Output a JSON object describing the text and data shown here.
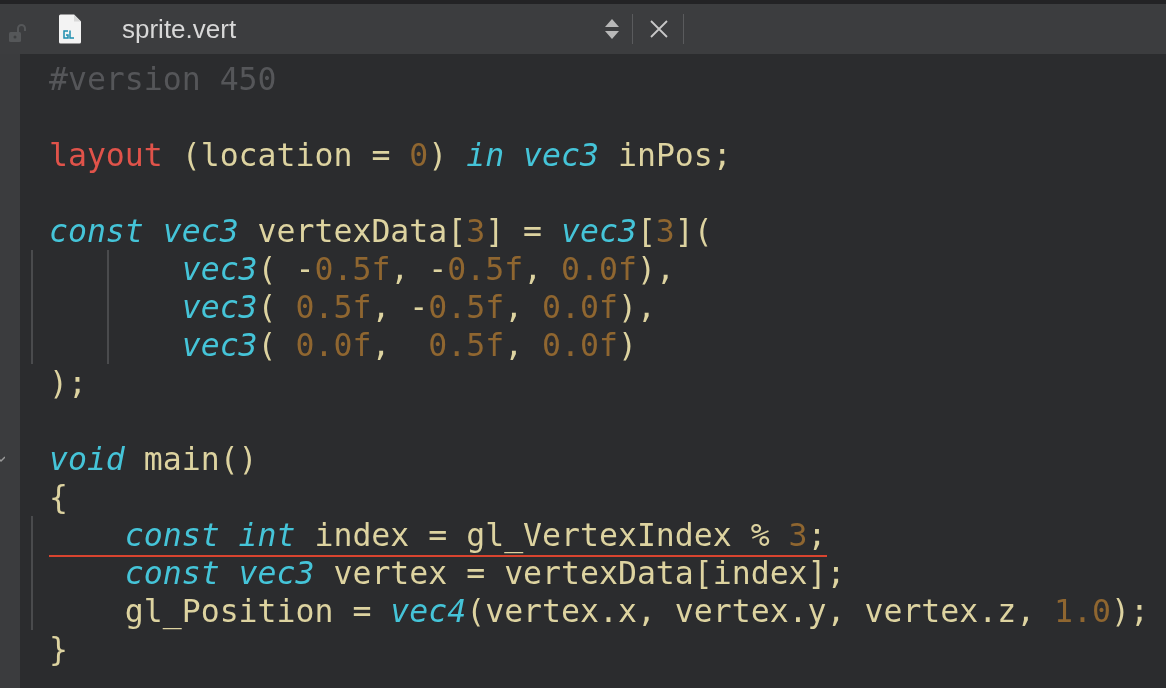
{
  "tab": {
    "title": "sprite.vert",
    "locked": false
  },
  "code": [
    {
      "kind": "code",
      "tokens": [
        {
          "t": "#version 450",
          "kind": "directive"
        }
      ]
    },
    {
      "kind": "blank"
    },
    {
      "kind": "code",
      "tokens": [
        {
          "t": "layout",
          "kind": "qualifier"
        },
        {
          "t": " (location = ",
          "kind": "plain"
        },
        {
          "t": "0",
          "kind": "number"
        },
        {
          "t": ") ",
          "kind": "plain"
        },
        {
          "t": "in vec3",
          "kind": "keyword"
        },
        {
          "t": " inPos;",
          "kind": "plain"
        }
      ]
    },
    {
      "kind": "blank"
    },
    {
      "kind": "code",
      "tokens": [
        {
          "t": "const vec3",
          "kind": "keyword"
        },
        {
          "t": " vertexData[",
          "kind": "plain"
        },
        {
          "t": "3",
          "kind": "number"
        },
        {
          "t": "] = ",
          "kind": "plain"
        },
        {
          "t": "vec3",
          "kind": "keyword"
        },
        {
          "t": "[",
          "kind": "plain"
        },
        {
          "t": "3",
          "kind": "number"
        },
        {
          "t": "](",
          "kind": "plain"
        }
      ]
    },
    {
      "kind": "code",
      "tokens": [
        {
          "t": "       vec3",
          "kind": "keyword"
        },
        {
          "t": "( -",
          "kind": "plain"
        },
        {
          "t": "0.5f",
          "kind": "number"
        },
        {
          "t": ", -",
          "kind": "plain"
        },
        {
          "t": "0.5f",
          "kind": "number"
        },
        {
          "t": ", ",
          "kind": "plain"
        },
        {
          "t": "0.0f",
          "kind": "number"
        },
        {
          "t": "),",
          "kind": "plain"
        }
      ]
    },
    {
      "kind": "code",
      "tokens": [
        {
          "t": "       vec3",
          "kind": "keyword"
        },
        {
          "t": "( ",
          "kind": "plain"
        },
        {
          "t": "0.5f",
          "kind": "number"
        },
        {
          "t": ", -",
          "kind": "plain"
        },
        {
          "t": "0.5f",
          "kind": "number"
        },
        {
          "t": ", ",
          "kind": "plain"
        },
        {
          "t": "0.0f",
          "kind": "number"
        },
        {
          "t": "),",
          "kind": "plain"
        }
      ]
    },
    {
      "kind": "code",
      "tokens": [
        {
          "t": "       vec3",
          "kind": "keyword"
        },
        {
          "t": "( ",
          "kind": "plain"
        },
        {
          "t": "0.0f",
          "kind": "number"
        },
        {
          "t": ",  ",
          "kind": "plain"
        },
        {
          "t": "0.5f",
          "kind": "number"
        },
        {
          "t": ", ",
          "kind": "plain"
        },
        {
          "t": "0.0f",
          "kind": "number"
        },
        {
          "t": ")",
          "kind": "plain"
        }
      ]
    },
    {
      "kind": "code",
      "tokens": [
        {
          "t": ");",
          "kind": "plain"
        }
      ]
    },
    {
      "kind": "blank"
    },
    {
      "kind": "code",
      "folded": false,
      "tokens": [
        {
          "t": "void",
          "kind": "keyword"
        },
        {
          "t": " main()",
          "kind": "plain"
        }
      ]
    },
    {
      "kind": "code",
      "tokens": [
        {
          "t": "{",
          "kind": "plain"
        }
      ]
    },
    {
      "kind": "code",
      "error": true,
      "tokens": [
        {
          "t": "    const int",
          "kind": "keyword"
        },
        {
          "t": " index = gl_VertexIndex % ",
          "kind": "plain"
        },
        {
          "t": "3",
          "kind": "number"
        },
        {
          "t": ";",
          "kind": "plain"
        }
      ]
    },
    {
      "kind": "code",
      "tokens": [
        {
          "t": "    const vec3",
          "kind": "keyword"
        },
        {
          "t": " vertex = vertexData[index];",
          "kind": "plain"
        }
      ]
    },
    {
      "kind": "code",
      "tokens": [
        {
          "t": "    gl_Position = ",
          "kind": "plain"
        },
        {
          "t": "vec4",
          "kind": "keyword"
        },
        {
          "t": "(vertex.x, vertex.y, vertex.z, ",
          "kind": "plain"
        },
        {
          "t": "1.0",
          "kind": "number"
        },
        {
          "t": ");",
          "kind": "plain"
        }
      ]
    },
    {
      "kind": "code",
      "tokens": [
        {
          "t": "}",
          "kind": "plain"
        }
      ]
    }
  ]
}
